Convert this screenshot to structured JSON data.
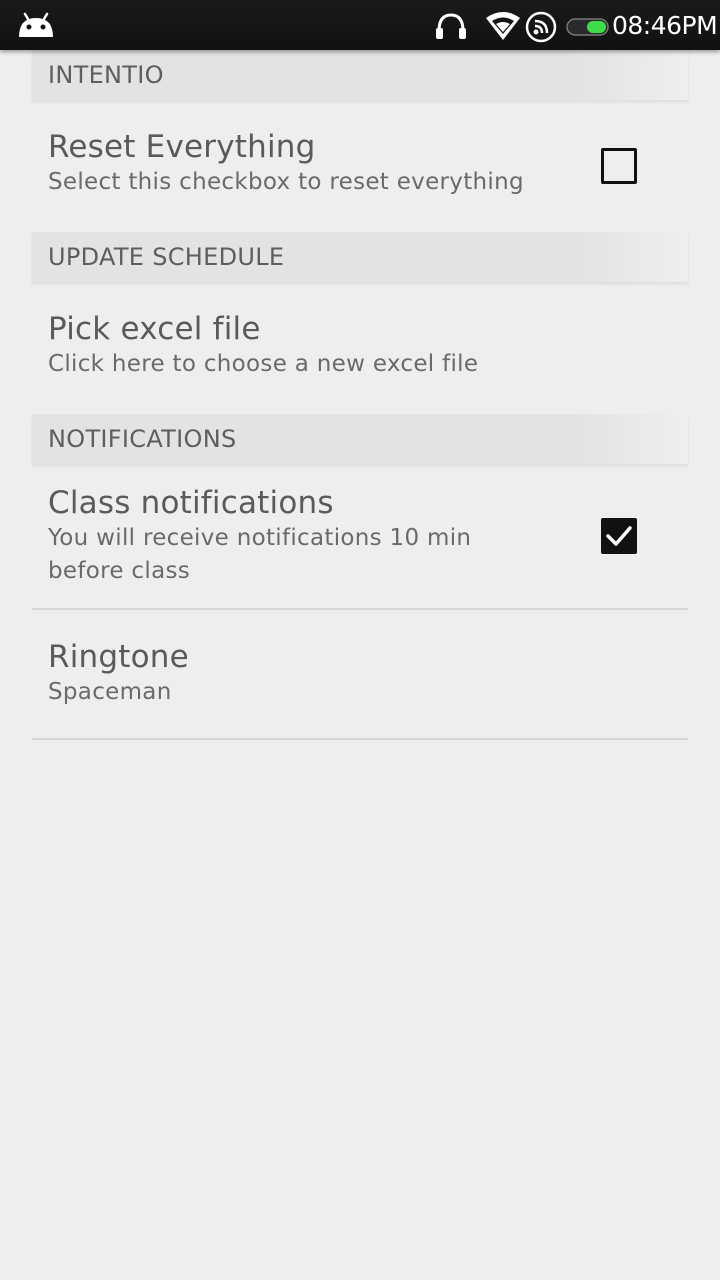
{
  "status_bar": {
    "time": "08:46PM",
    "icons": [
      "android-icon",
      "headset-icon",
      "wifi-icon",
      "hotspot-icon",
      "battery-icon"
    ],
    "battery_color": "#3ddc4a"
  },
  "preferences": {
    "intentio": {
      "category_title": "INTENTIO",
      "reset": {
        "title": "Reset Everything",
        "summary": "Select this checkbox to reset everything",
        "checked": false
      }
    },
    "update_schedule": {
      "category_title": "UPDATE SCHEDULE",
      "pick_excel": {
        "title": "Pick excel file",
        "summary": "Click here to choose a new excel file"
      }
    },
    "notifications": {
      "category_title": "NOTIFICATIONS",
      "class_notifications": {
        "title": "Class notifications",
        "summary": "You will receive notifications 10 min before class",
        "checked": true
      },
      "ringtone": {
        "title": "Ringtone",
        "summary": "Spaceman"
      }
    }
  },
  "colors": {
    "background": "#eeeeee",
    "status_bar": "#141414",
    "text": "#5f5f5f",
    "checkbox": "#111111"
  }
}
